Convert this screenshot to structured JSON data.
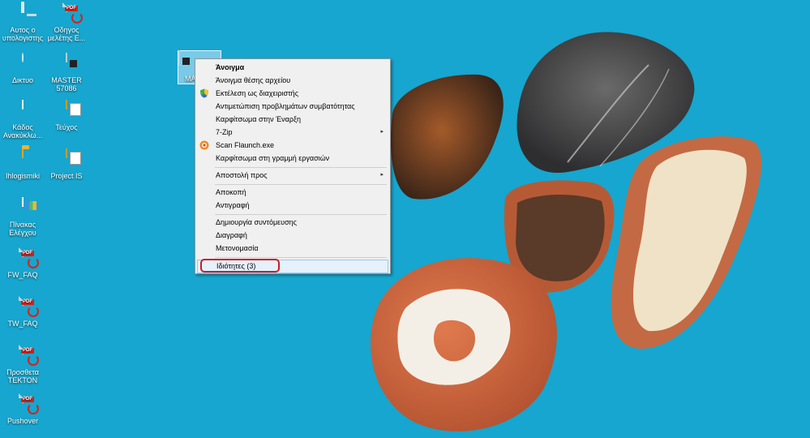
{
  "desktop": {
    "icons": [
      {
        "label": "Αυτος ο υπολογιστης",
        "icon": "computer-icon"
      },
      {
        "label": "Οδηγος μελέτης Ε...",
        "icon": "pdf-icon"
      },
      {
        "label": "Δικτυο",
        "icon": "network-icon"
      },
      {
        "label": "MASTER 57086",
        "icon": "document-icon"
      },
      {
        "label": "Κάδος Ανακύκλω...",
        "icon": "recycle-bin-icon"
      },
      {
        "label": "Τεύχος",
        "icon": "folder-icon"
      },
      {
        "label": "Ihlogismiki",
        "icon": "folder-icon"
      },
      {
        "label": "Project IS",
        "icon": "document-folder-icon"
      },
      {
        "label": "Πίνακας Ελέγχου",
        "icon": "control-panel-icon"
      },
      {
        "label": "FW_FAQ",
        "icon": "pdf-icon"
      },
      {
        "label": "TW_FAQ",
        "icon": "pdf-icon"
      },
      {
        "label": "Προσθετα TEKTON",
        "icon": "pdf-icon"
      },
      {
        "label": "Pushover",
        "icon": "pdf-icon"
      }
    ],
    "selected_file_label": "MA",
    "pdf_tag": "PDF"
  },
  "context_menu": {
    "items": [
      {
        "label": "Άνοιγμα",
        "bold": true
      },
      {
        "label": "Άνοιγμα θέσης αρχείου"
      },
      {
        "label": "Εκτέλεση ως διαχειριστής",
        "icon": "shield-icon"
      },
      {
        "label": "Αντιμετώπιση προβλημάτων συμβατότητας"
      },
      {
        "label": "Καρφίτσωμα στην Έναρξη"
      },
      {
        "label": "7-Zip",
        "submenu": true
      },
      {
        "label": "Scan Flaunch.exe",
        "icon": "antivirus-icon"
      },
      {
        "label": "Καρφίτσωμα στη γραμμή εργασιών"
      },
      {
        "label": "Αποστολή προς",
        "submenu": true
      },
      {
        "label": "Αποκοπή"
      },
      {
        "label": "Αντιγραφή"
      },
      {
        "label": "Δημιουργία συντόμευσης"
      },
      {
        "label": "Διαγραφή"
      },
      {
        "label": "Μετονομασία"
      },
      {
        "label": "Ιδιότητες (3)",
        "highlighted": true
      }
    ],
    "submenu_arrow": "▸"
  },
  "colors": {
    "desktop_bg": "#16a6cf",
    "highlight_ring": "#d11a22",
    "menu_bg": "#f0f0f0"
  }
}
